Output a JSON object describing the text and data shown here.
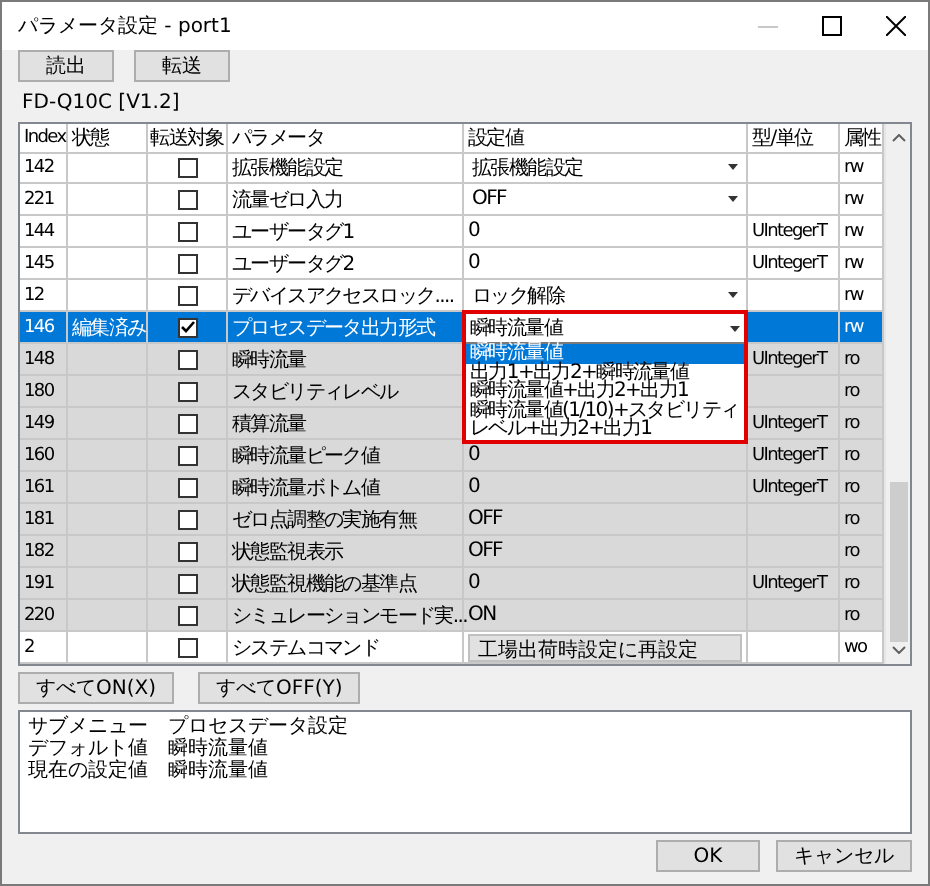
{
  "window": {
    "title": "パラメータ設定 - port1"
  },
  "toolbar": [
    "読出",
    "転送"
  ],
  "device_label": "FD-Q10C [V1.2]",
  "table": {
    "columns": [
      "Index",
      "状態",
      "転送対象",
      "パラメータ",
      "設定値",
      "型/単位",
      "属性"
    ],
    "rows": [
      {
        "index": "142",
        "status": "",
        "transfer": false,
        "parameter": "拡張機能設定",
        "kind": "dropdown",
        "value": "拡張機能設定",
        "unit": "",
        "access": "rw",
        "selected": false,
        "disabled": false
      },
      {
        "index": "221",
        "status": "",
        "transfer": false,
        "parameter": "流量ゼロ入力",
        "kind": "dropdown",
        "value": "OFF",
        "unit": "",
        "access": "rw",
        "selected": false,
        "disabled": false
      },
      {
        "index": "144",
        "status": "",
        "transfer": false,
        "parameter": "ユーザータグ1",
        "kind": "text",
        "value": "0",
        "unit": "UIntegerT",
        "access": "rw",
        "selected": false,
        "disabled": false
      },
      {
        "index": "145",
        "status": "",
        "transfer": false,
        "parameter": "ユーザータグ2",
        "kind": "text",
        "value": "0",
        "unit": "UIntegerT",
        "access": "rw",
        "selected": false,
        "disabled": false
      },
      {
        "index": "12",
        "status": "",
        "transfer": false,
        "parameter": "デバイスアクセスロック....",
        "kind": "dropdown",
        "value": "ロック解除",
        "unit": "",
        "access": "rw",
        "selected": false,
        "disabled": false
      },
      {
        "index": "146",
        "status": "編集済み",
        "transfer": true,
        "parameter": "プロセスデータ出力形式",
        "kind": "dropdown",
        "value": "瞬時流量値",
        "unit": "",
        "access": "rw",
        "selected": true,
        "disabled": false,
        "open": true,
        "options": [
          {
            "label": "瞬時流量値",
            "selected": true
          },
          {
            "label": "出力1+出力2+瞬時流量値",
            "selected": false
          },
          {
            "label": "瞬時流量値+出力2+出力1",
            "selected": false
          },
          {
            "label": "瞬時流量値(1/10)+スタビリティレベル+出力2+出力1",
            "selected": false
          }
        ]
      },
      {
        "index": "148",
        "status": "",
        "transfer": false,
        "parameter": "瞬時流量",
        "kind": "text",
        "unit": "UIntegerT",
        "access": "ro",
        "selected": false,
        "disabled": true
      },
      {
        "index": "180",
        "status": "",
        "transfer": false,
        "parameter": "スタビリティレベル",
        "kind": "text",
        "unit": "",
        "access": "ro",
        "selected": false,
        "disabled": true
      },
      {
        "index": "149",
        "status": "",
        "transfer": false,
        "parameter": "積算流量",
        "kind": "text",
        "unit": "UIntegerT",
        "access": "ro",
        "selected": false,
        "disabled": true
      },
      {
        "index": "160",
        "status": "",
        "transfer": false,
        "parameter": "瞬時流量ピーク値",
        "kind": "text",
        "value": "0",
        "unit": "UIntegerT",
        "access": "ro",
        "selected": false,
        "disabled": true
      },
      {
        "index": "161",
        "status": "",
        "transfer": false,
        "parameter": "瞬時流量ボトム値",
        "kind": "text",
        "value": "0",
        "unit": "UIntegerT",
        "access": "ro",
        "selected": false,
        "disabled": true
      },
      {
        "index": "181",
        "status": "",
        "transfer": false,
        "parameter": "ゼロ点調整の実施有無",
        "kind": "text",
        "value": "OFF",
        "unit": "",
        "access": "ro",
        "selected": false,
        "disabled": true
      },
      {
        "index": "182",
        "status": "",
        "transfer": false,
        "parameter": "状態監視表示",
        "kind": "text",
        "value": "OFF",
        "unit": "",
        "access": "ro",
        "selected": false,
        "disabled": true
      },
      {
        "index": "191",
        "status": "",
        "transfer": false,
        "parameter": "状態監視機能の基準点",
        "kind": "text",
        "value": "0",
        "unit": "UIntegerT",
        "access": "ro",
        "selected": false,
        "disabled": true
      },
      {
        "index": "220",
        "status": "",
        "transfer": false,
        "parameter": "シミュレーションモード実...",
        "kind": "text",
        "value": "ON",
        "unit": "",
        "access": "ro",
        "selected": false,
        "disabled": true
      },
      {
        "index": "2",
        "status": "",
        "transfer": false,
        "parameter": "システムコマンド",
        "kind": "button",
        "value": "工場出荷時設定に再設定",
        "unit": "",
        "access": "wo",
        "selected": false,
        "disabled": false
      }
    ]
  },
  "bulk_buttons": [
    "すべてON(X)",
    "すべてOFF(Y)"
  ],
  "details": [
    {
      "label": "サブメニュー",
      "value": "プロセスデータ設定"
    },
    {
      "label": "デフォルト値",
      "value": "瞬時流量値"
    },
    {
      "label": "現在の設定値",
      "value": "瞬時流量値"
    }
  ],
  "footer_buttons": [
    "OK",
    "キャンセル"
  ]
}
